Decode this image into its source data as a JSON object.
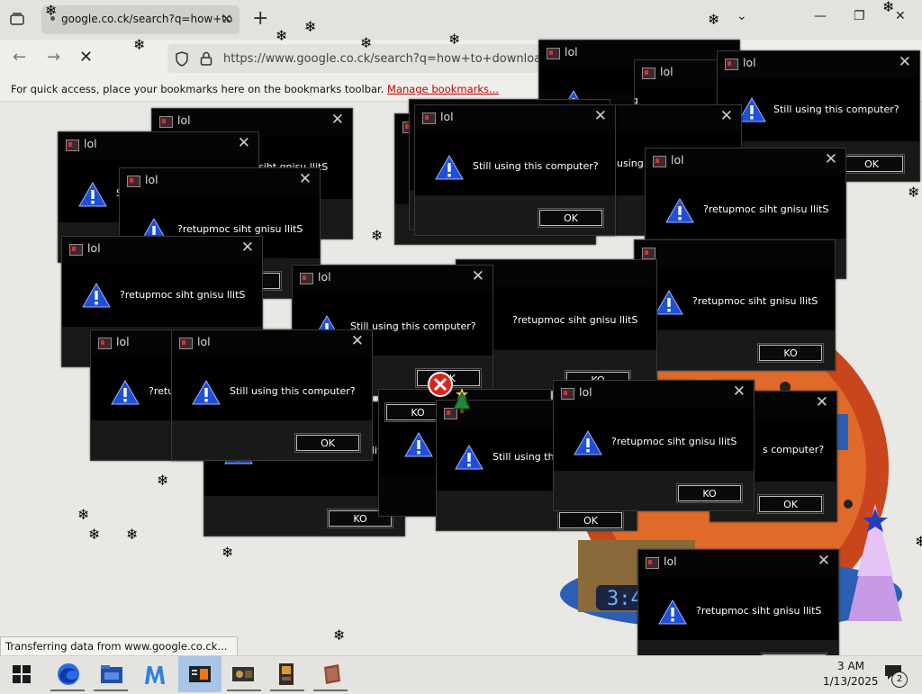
{
  "browser": {
    "tab_title": "google.co.ck/search?q=how+to",
    "url": "https://www.google.co.ck/search?q=how+to+download+",
    "bookmarks_hint": "For quick access, place your bookmarks here on the bookmarks toolbar.",
    "bookmarks_link": "Manage bookmarks...",
    "status_text": "Transferring data from www.google.co.ck..."
  },
  "dialog_title": "lol",
  "messages": {
    "normal": "Still using this computer?",
    "reversed": "?retupmoc siht gnisu llitS"
  },
  "buttons": {
    "ok": "OK",
    "ko": "KO"
  },
  "fragments": {
    "tail_computer": "s computer?",
    "frag_still_using": "Still using thi",
    "frag_retu": "?retu",
    "frag_using": "using",
    "frag_s": "S",
    "frag_upmoc": "upmoc",
    "frag_llits": "siht gnisu llitS",
    "frag_using2": "using"
  },
  "taskbar": {
    "time": "3 AM",
    "date": "1/13/2025",
    "notification_count": "2"
  },
  "globe_clock": "3:45",
  "colors": {
    "warning": "#1f4fd8",
    "dialog_bg": "#000000",
    "bookmark_link": "#c40000"
  }
}
